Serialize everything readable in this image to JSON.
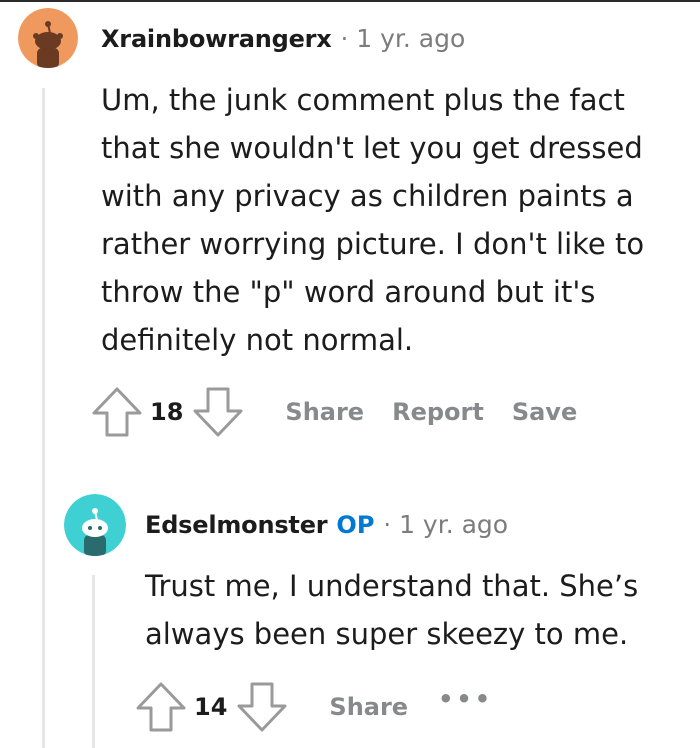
{
  "comments": [
    {
      "username": "Xrainbowrangerx",
      "separator": "·",
      "time": "1 yr. ago",
      "lines": [
        "Um, the junk comment plus the fact",
        "that she wouldn't let you get dressed",
        "with any privacy as children paints a",
        "rather worrying picture. I don't like to",
        "throw the \"p\" word around but it's",
        "definitely not normal."
      ],
      "score": "18",
      "actions": {
        "share": "Share",
        "report": "Report",
        "save": "Save"
      },
      "avatar_color": "#f0995e"
    },
    {
      "username": "Edselmonster",
      "op_badge": "OP",
      "separator": "·",
      "time": "1 yr. ago",
      "lines": [
        "Trust me, I understand that. She’s",
        "always been super skeezy to me."
      ],
      "score": "14",
      "actions": {
        "share": "Share",
        "more": "•••"
      },
      "avatar_color": "#3fd0d4"
    }
  ],
  "colors": {
    "text": "#1c1c1c",
    "muted": "#7c7c7c",
    "action": "#878a8c",
    "op_blue": "#0079d3",
    "thread_line": "#e6e6e6"
  },
  "icons": [
    "snoo-avatar-icon",
    "upvote-arrow-icon",
    "downvote-arrow-icon",
    "more-options-icon"
  ]
}
